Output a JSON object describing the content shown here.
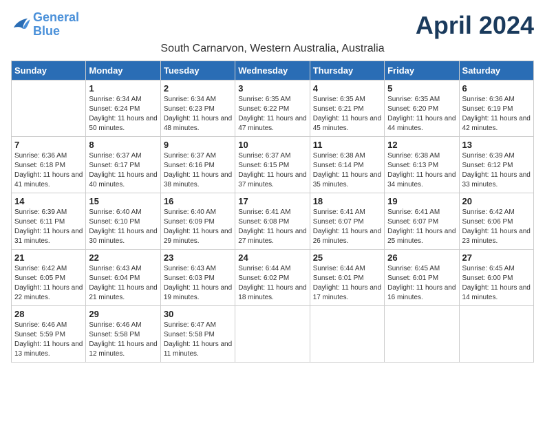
{
  "logo": {
    "line1": "General",
    "line2": "Blue"
  },
  "title": "April 2024",
  "subtitle": "South Carnarvon, Western Australia, Australia",
  "days_of_week": [
    "Sunday",
    "Monday",
    "Tuesday",
    "Wednesday",
    "Thursday",
    "Friday",
    "Saturday"
  ],
  "weeks": [
    [
      {
        "num": "",
        "info": ""
      },
      {
        "num": "1",
        "info": "Sunrise: 6:34 AM\nSunset: 6:24 PM\nDaylight: 11 hours\nand 50 minutes."
      },
      {
        "num": "2",
        "info": "Sunrise: 6:34 AM\nSunset: 6:23 PM\nDaylight: 11 hours\nand 48 minutes."
      },
      {
        "num": "3",
        "info": "Sunrise: 6:35 AM\nSunset: 6:22 PM\nDaylight: 11 hours\nand 47 minutes."
      },
      {
        "num": "4",
        "info": "Sunrise: 6:35 AM\nSunset: 6:21 PM\nDaylight: 11 hours\nand 45 minutes."
      },
      {
        "num": "5",
        "info": "Sunrise: 6:35 AM\nSunset: 6:20 PM\nDaylight: 11 hours\nand 44 minutes."
      },
      {
        "num": "6",
        "info": "Sunrise: 6:36 AM\nSunset: 6:19 PM\nDaylight: 11 hours\nand 42 minutes."
      }
    ],
    [
      {
        "num": "7",
        "info": "Sunrise: 6:36 AM\nSunset: 6:18 PM\nDaylight: 11 hours\nand 41 minutes."
      },
      {
        "num": "8",
        "info": "Sunrise: 6:37 AM\nSunset: 6:17 PM\nDaylight: 11 hours\nand 40 minutes."
      },
      {
        "num": "9",
        "info": "Sunrise: 6:37 AM\nSunset: 6:16 PM\nDaylight: 11 hours\nand 38 minutes."
      },
      {
        "num": "10",
        "info": "Sunrise: 6:37 AM\nSunset: 6:15 PM\nDaylight: 11 hours\nand 37 minutes."
      },
      {
        "num": "11",
        "info": "Sunrise: 6:38 AM\nSunset: 6:14 PM\nDaylight: 11 hours\nand 35 minutes."
      },
      {
        "num": "12",
        "info": "Sunrise: 6:38 AM\nSunset: 6:13 PM\nDaylight: 11 hours\nand 34 minutes."
      },
      {
        "num": "13",
        "info": "Sunrise: 6:39 AM\nSunset: 6:12 PM\nDaylight: 11 hours\nand 33 minutes."
      }
    ],
    [
      {
        "num": "14",
        "info": "Sunrise: 6:39 AM\nSunset: 6:11 PM\nDaylight: 11 hours\nand 31 minutes."
      },
      {
        "num": "15",
        "info": "Sunrise: 6:40 AM\nSunset: 6:10 PM\nDaylight: 11 hours\nand 30 minutes."
      },
      {
        "num": "16",
        "info": "Sunrise: 6:40 AM\nSunset: 6:09 PM\nDaylight: 11 hours\nand 29 minutes."
      },
      {
        "num": "17",
        "info": "Sunrise: 6:41 AM\nSunset: 6:08 PM\nDaylight: 11 hours\nand 27 minutes."
      },
      {
        "num": "18",
        "info": "Sunrise: 6:41 AM\nSunset: 6:07 PM\nDaylight: 11 hours\nand 26 minutes."
      },
      {
        "num": "19",
        "info": "Sunrise: 6:41 AM\nSunset: 6:07 PM\nDaylight: 11 hours\nand 25 minutes."
      },
      {
        "num": "20",
        "info": "Sunrise: 6:42 AM\nSunset: 6:06 PM\nDaylight: 11 hours\nand 23 minutes."
      }
    ],
    [
      {
        "num": "21",
        "info": "Sunrise: 6:42 AM\nSunset: 6:05 PM\nDaylight: 11 hours\nand 22 minutes."
      },
      {
        "num": "22",
        "info": "Sunrise: 6:43 AM\nSunset: 6:04 PM\nDaylight: 11 hours\nand 21 minutes."
      },
      {
        "num": "23",
        "info": "Sunrise: 6:43 AM\nSunset: 6:03 PM\nDaylight: 11 hours\nand 19 minutes."
      },
      {
        "num": "24",
        "info": "Sunrise: 6:44 AM\nSunset: 6:02 PM\nDaylight: 11 hours\nand 18 minutes."
      },
      {
        "num": "25",
        "info": "Sunrise: 6:44 AM\nSunset: 6:01 PM\nDaylight: 11 hours\nand 17 minutes."
      },
      {
        "num": "26",
        "info": "Sunrise: 6:45 AM\nSunset: 6:01 PM\nDaylight: 11 hours\nand 16 minutes."
      },
      {
        "num": "27",
        "info": "Sunrise: 6:45 AM\nSunset: 6:00 PM\nDaylight: 11 hours\nand 14 minutes."
      }
    ],
    [
      {
        "num": "28",
        "info": "Sunrise: 6:46 AM\nSunset: 5:59 PM\nDaylight: 11 hours\nand 13 minutes."
      },
      {
        "num": "29",
        "info": "Sunrise: 6:46 AM\nSunset: 5:58 PM\nDaylight: 11 hours\nand 12 minutes."
      },
      {
        "num": "30",
        "info": "Sunrise: 6:47 AM\nSunset: 5:58 PM\nDaylight: 11 hours\nand 11 minutes."
      },
      {
        "num": "",
        "info": ""
      },
      {
        "num": "",
        "info": ""
      },
      {
        "num": "",
        "info": ""
      },
      {
        "num": "",
        "info": ""
      }
    ]
  ]
}
